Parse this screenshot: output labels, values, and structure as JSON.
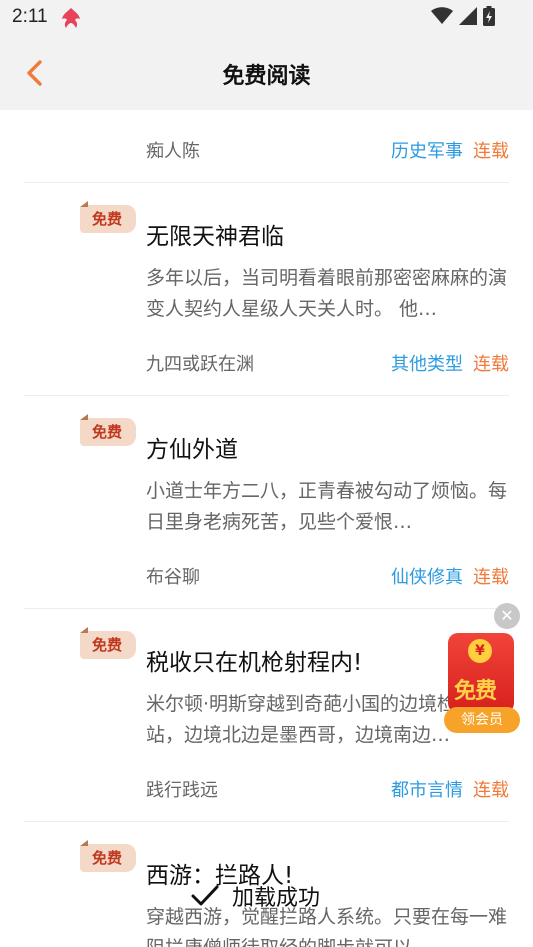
{
  "status_bar": {
    "time": "2:11"
  },
  "nav": {
    "title": "免费阅读"
  },
  "badge_label": "免费",
  "books": [
    {
      "title": "",
      "desc": "",
      "author": "痴人陈",
      "category": "历史军事",
      "status": "连载"
    },
    {
      "title": "无限天神君临",
      "desc": "多年以后，当司明看着眼前那密密麻麻的演变人契约人星级人天关人时。 他…",
      "author": "九四或跃在渊",
      "category": "其他类型",
      "status": "连载"
    },
    {
      "title": "方仙外道",
      "desc": "小道士年方二八，正青春被勾动了烦恼。每日里身老病死苦，见些个爱恨…",
      "author": "布谷聊",
      "category": "仙侠修真",
      "status": "连载"
    },
    {
      "title": "税收只在机枪射程内!",
      "desc": "米尔顿·明斯穿越到奇葩小国的边境检查站，边境北边是墨西哥，边境南边…",
      "author": "践行践远",
      "category": "都市言情",
      "status": "连载"
    },
    {
      "title": "西游：拦路人!",
      "desc": "穿越西游，觉醒拦路人系统。只要在每一难阻拦唐僧师徒取经的脚步就可以…",
      "author": "",
      "category": "",
      "status": ""
    }
  ],
  "promo": {
    "coin": "¥",
    "free": "免费",
    "member": "领会员"
  },
  "toast": {
    "text": "加载成功"
  },
  "colors": {
    "accent": "#f07a3a",
    "category": "#2c9be0",
    "badge": "#c0391f"
  }
}
